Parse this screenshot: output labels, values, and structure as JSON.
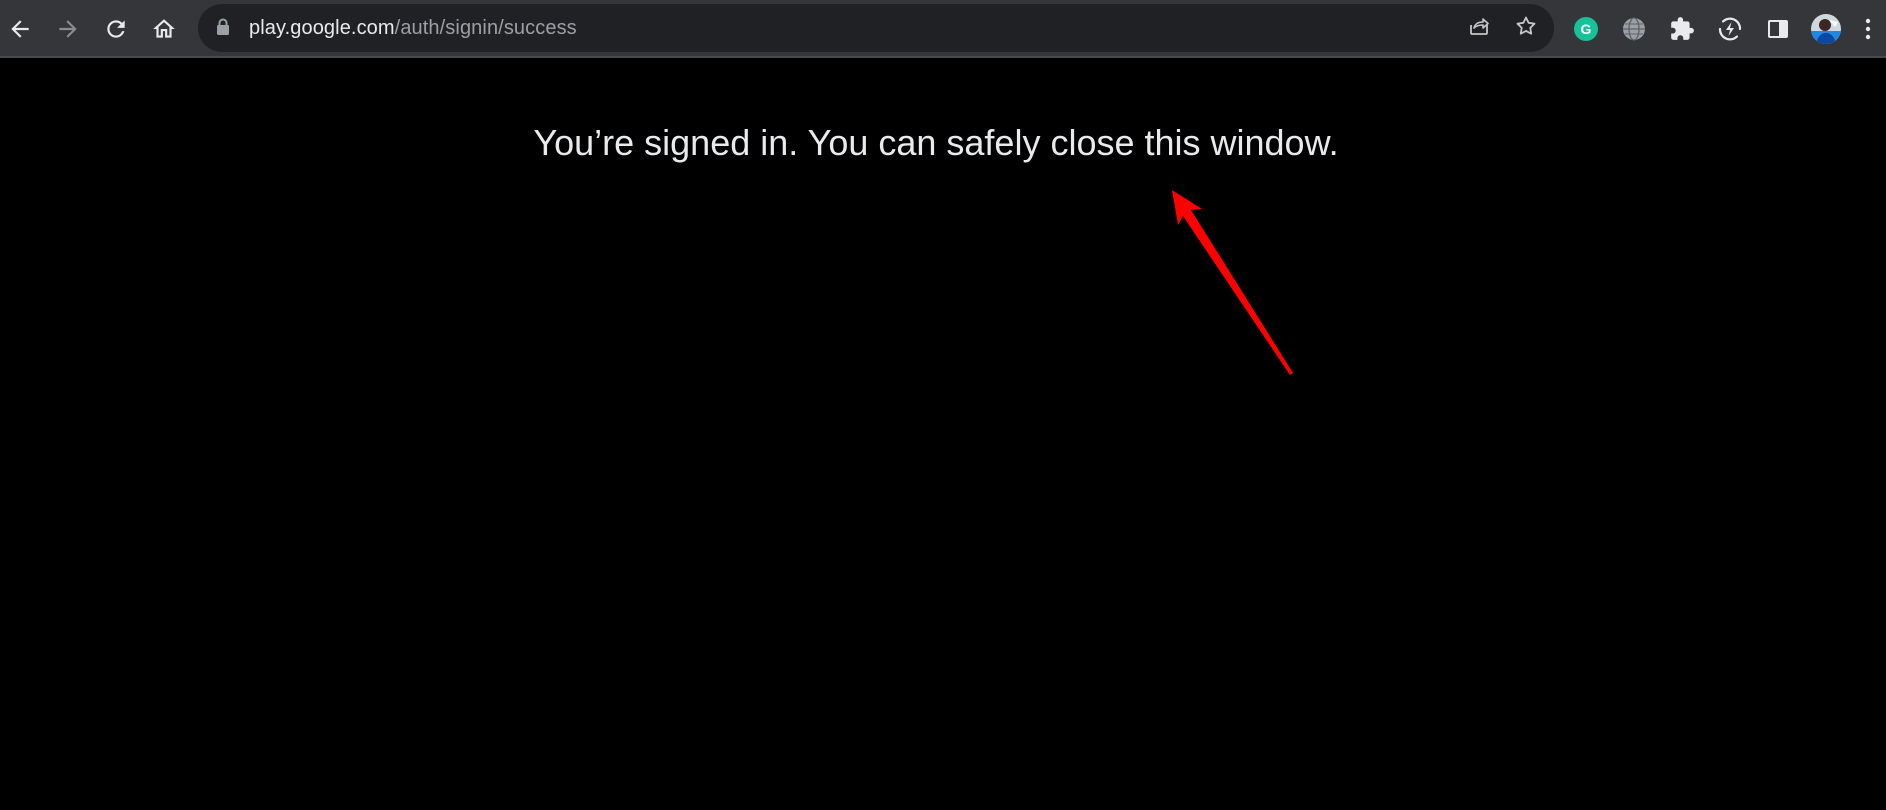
{
  "browser": {
    "url_host": "play.google.com",
    "url_path": "/auth/signin/success",
    "toolbar_icons": [
      "back-icon",
      "forward-icon",
      "reload-icon",
      "home-icon"
    ],
    "omnibox_icons": [
      "lock-icon",
      "share-icon",
      "bookmark-star-icon"
    ],
    "extension_icons": [
      "grammarly-icon",
      "globe-extension-icon",
      "extensions-puzzle-icon",
      "lightning-extension-icon",
      "side-panel-icon",
      "profile-avatar",
      "menu-kebab-icon"
    ],
    "colors": {
      "toolbar": "#35363a",
      "omnibox": "#202124",
      "grammarly": "#15c39a",
      "page_bg": "#000000",
      "annotation_arrow": "#ff0000"
    }
  },
  "page": {
    "message": "You’re signed in. You can safely close this window."
  },
  "annotation": {
    "type": "red-arrow",
    "points_to": "page-message"
  }
}
